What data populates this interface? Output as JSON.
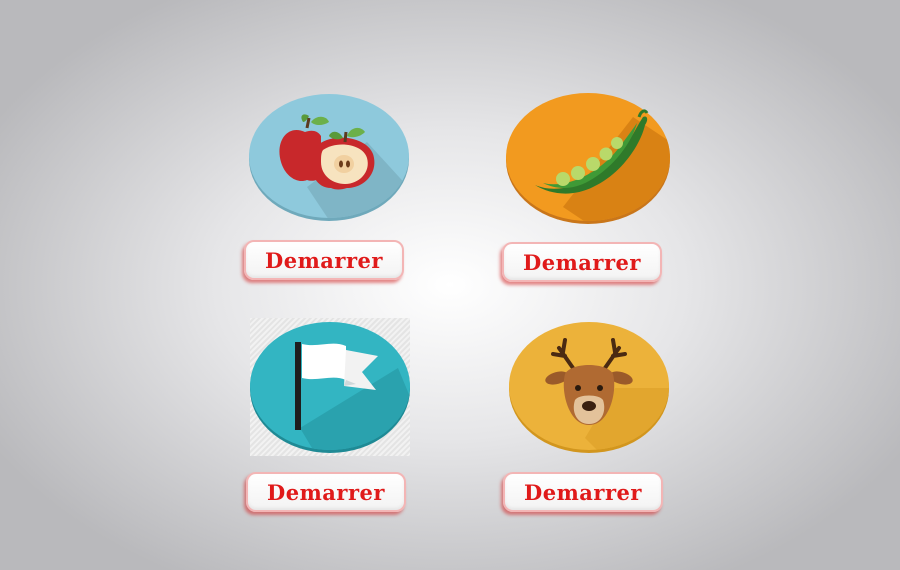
{
  "tiles": [
    {
      "icon": "apple-icon",
      "button_label": "Demarrer",
      "color": "#8ec9dc"
    },
    {
      "icon": "pea-pod-icon",
      "button_label": "Demarrer",
      "color": "#f29a1f"
    },
    {
      "icon": "flag-icon",
      "button_label": "Demarrer",
      "color": "#33b5c2"
    },
    {
      "icon": "deer-icon",
      "button_label": "Demarrer",
      "color": "#ecb23a"
    }
  ],
  "colors": {
    "button_text": "#e01a1a",
    "button_border": "#f3b5b5"
  }
}
